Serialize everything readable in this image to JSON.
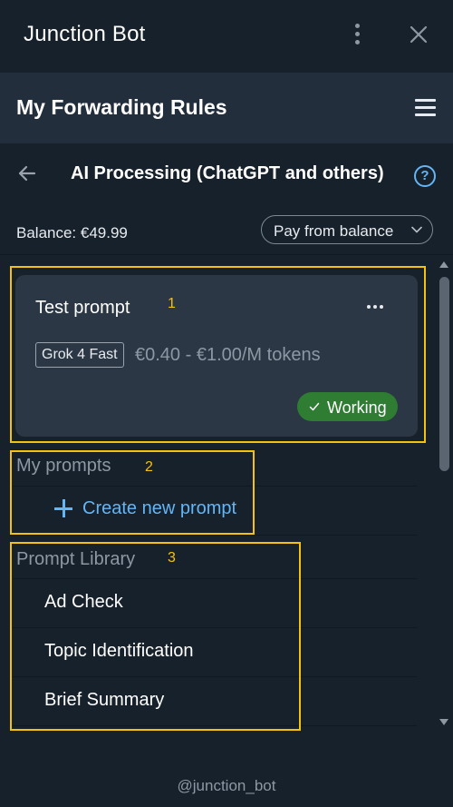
{
  "window": {
    "title": "Junction Bot",
    "more_icon": "vertical-dots-icon",
    "close_icon": "close-icon"
  },
  "header": {
    "title": "My Forwarding Rules",
    "menu_icon": "hamburger-menu-icon"
  },
  "page": {
    "title": "AI Processing (ChatGPT and others)",
    "back_icon": "back-arrow-icon",
    "help_icon": "help-circle-icon",
    "help_glyph": "?"
  },
  "billing": {
    "balance_label": "Balance: €49.99",
    "payment_method": "Pay from balance"
  },
  "active_prompt": {
    "title": "Test prompt",
    "model": "Grok 4 Fast",
    "price": "€0.40 - €1.00/M tokens",
    "status": "Working"
  },
  "my_prompts": {
    "header": "My prompts",
    "create_label": "Create new prompt"
  },
  "library": {
    "header": "Prompt Library",
    "items": [
      "Ad Check",
      "Topic Identification",
      "Brief Summary"
    ]
  },
  "annotations": [
    "1",
    "2",
    "3"
  ],
  "footer": {
    "handle": "@junction_bot"
  },
  "colors": {
    "background": "#17212b",
    "header_bg": "#232e3c",
    "card_bg": "#2b3744",
    "accent": "#64b5f6",
    "status_green": "#2e7d32",
    "annotation": "#f4c20d"
  }
}
